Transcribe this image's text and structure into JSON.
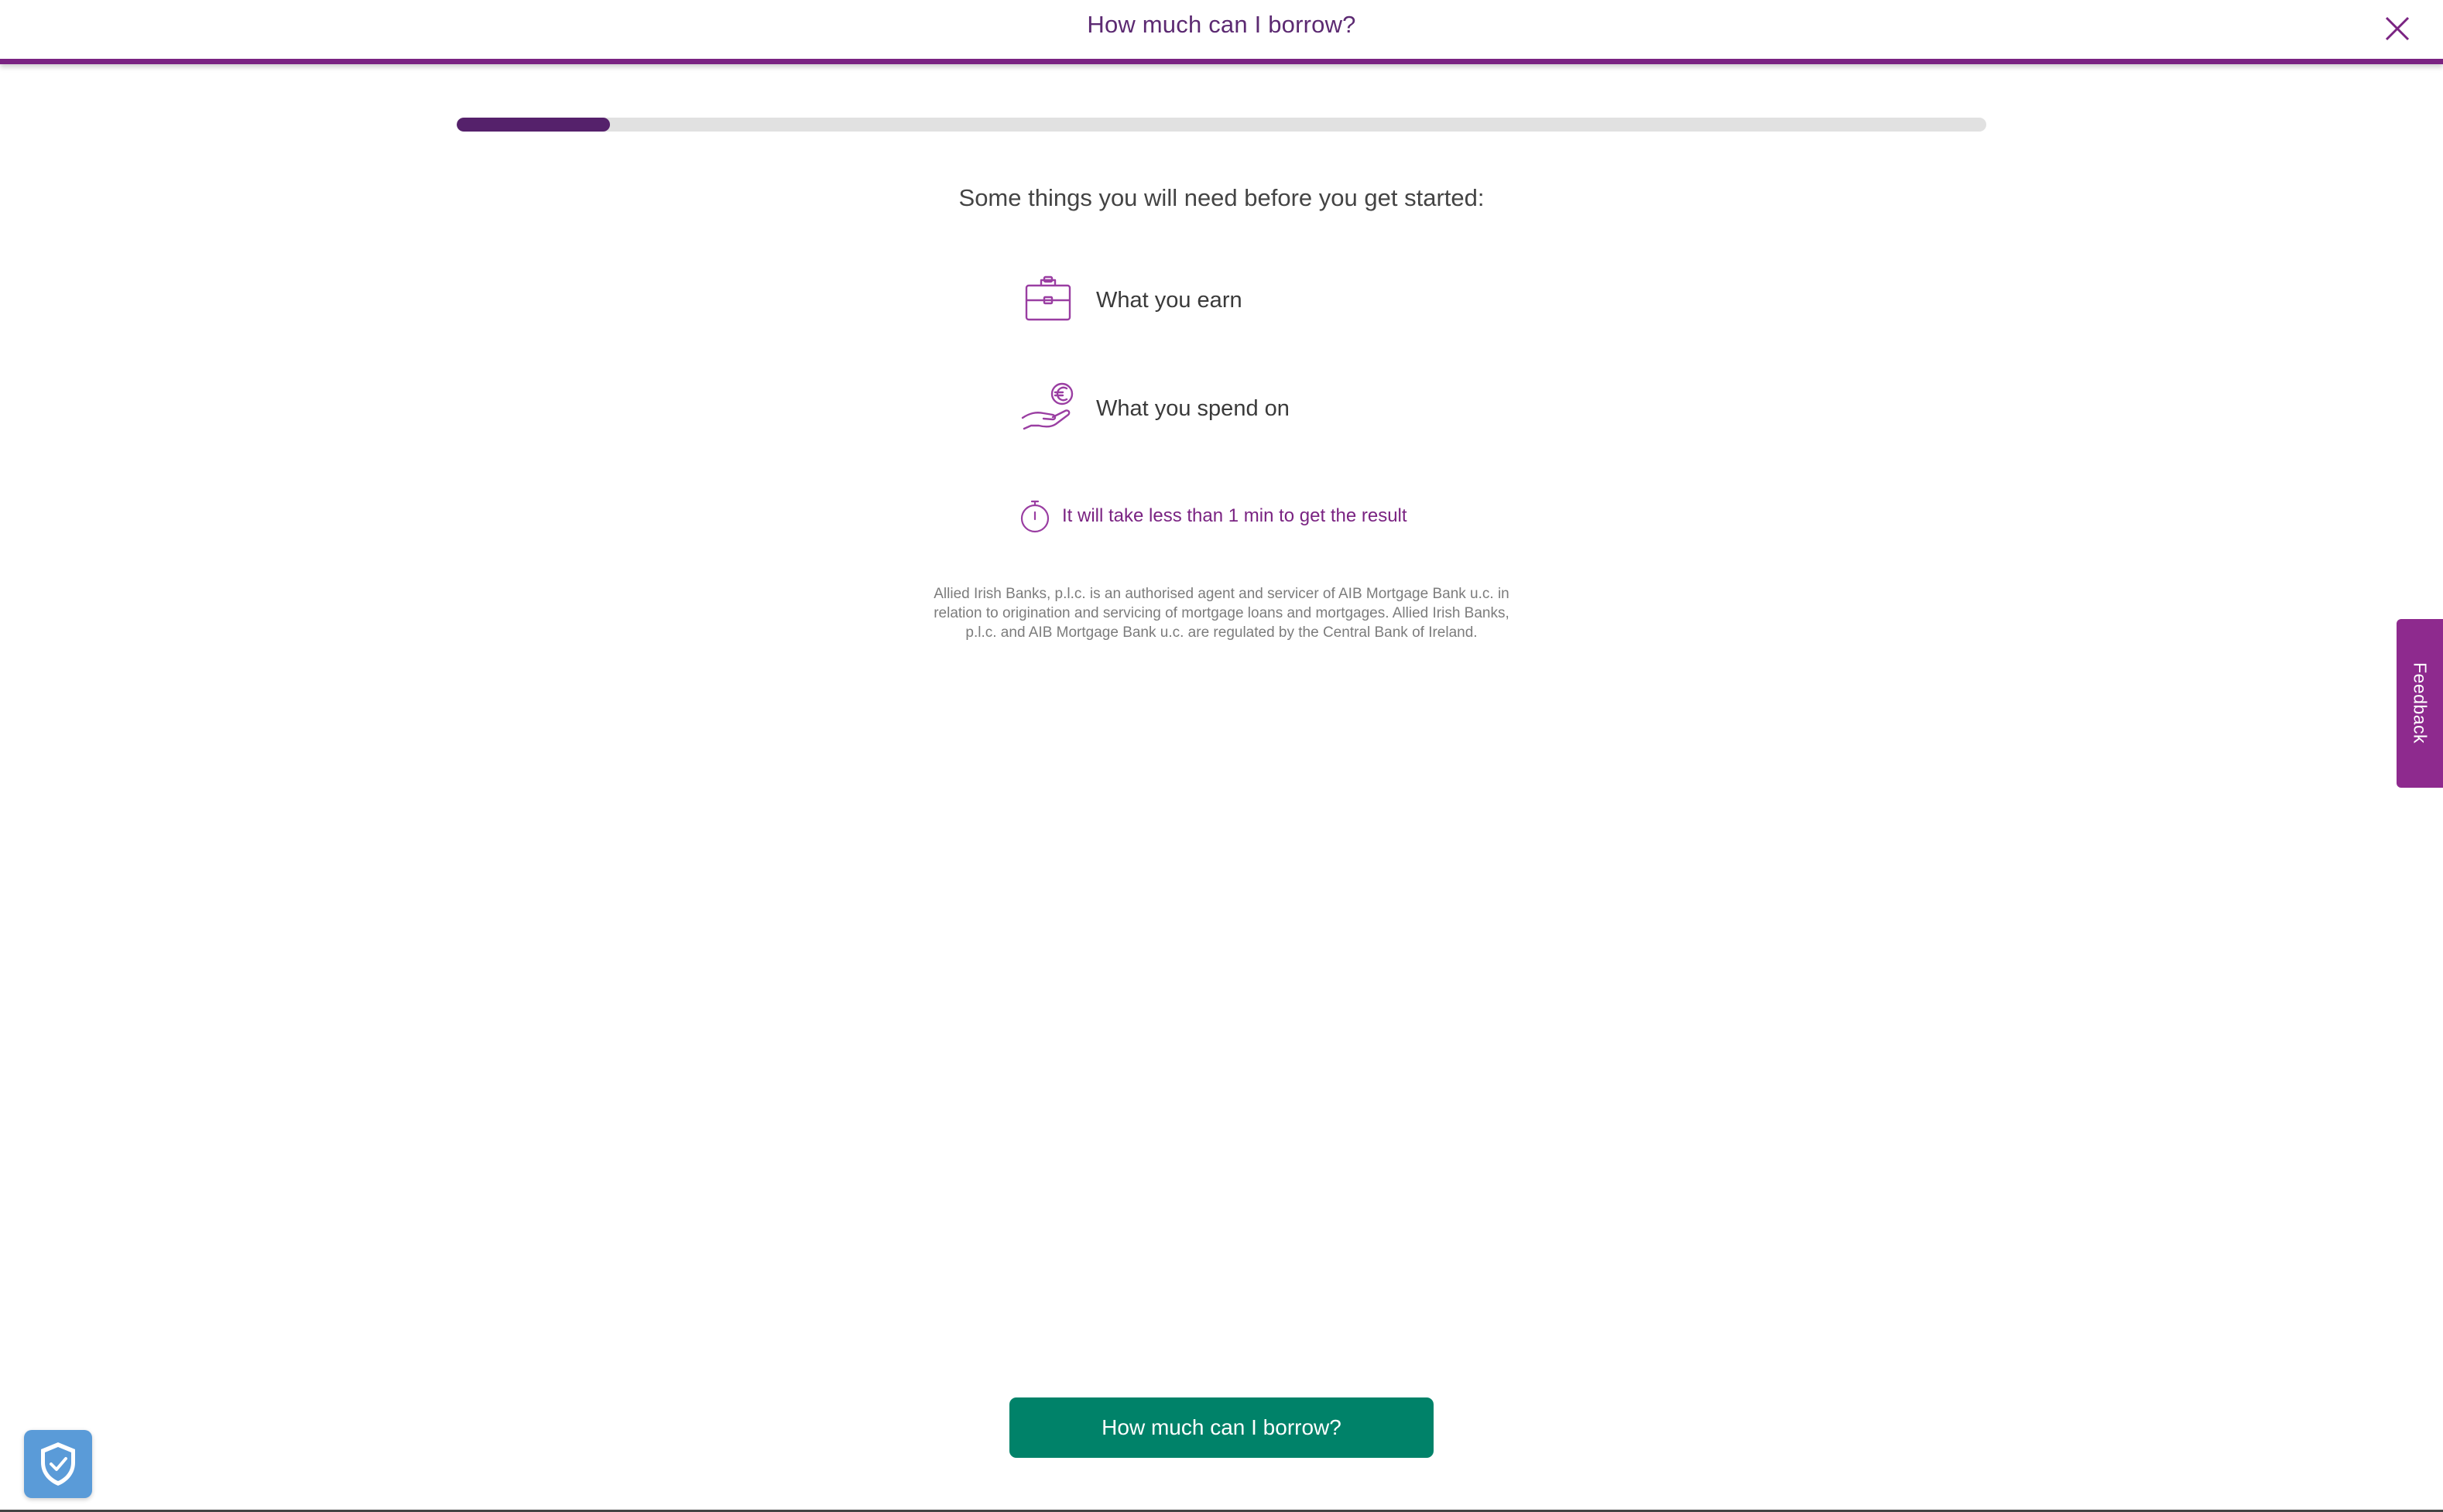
{
  "header": {
    "title": "How much can I borrow?",
    "close_icon": "close-icon",
    "accent_color": "#7a2382"
  },
  "progress": {
    "percent": 10,
    "fill_color": "#55216b",
    "track_color": "#e1e1e1"
  },
  "intro": {
    "text": "Some things you will need before you get started:"
  },
  "requirements": [
    {
      "icon": "briefcase-icon",
      "label": "What you earn"
    },
    {
      "icon": "hand-euro-icon",
      "label": "What you spend on"
    }
  ],
  "time_note": {
    "icon": "stopwatch-icon",
    "text": "It will take less than 1 min to get the result"
  },
  "disclaimer": {
    "text": "Allied Irish Banks, p.l.c. is an authorised agent and servicer of AIB Mortgage Bank u.c. in relation to origination and servicing of mortgage loans and mortgages. Allied Irish Banks, p.l.c. and AIB Mortgage Bank u.c. are regulated by the Central Bank of Ireland."
  },
  "feedback": {
    "label": "Feedback",
    "color": "#8e2a8e"
  },
  "cta": {
    "label": "How much can I borrow?",
    "color": "#008269"
  },
  "privacy": {
    "icon": "shield-check-icon",
    "color": "#5a9bd8"
  }
}
